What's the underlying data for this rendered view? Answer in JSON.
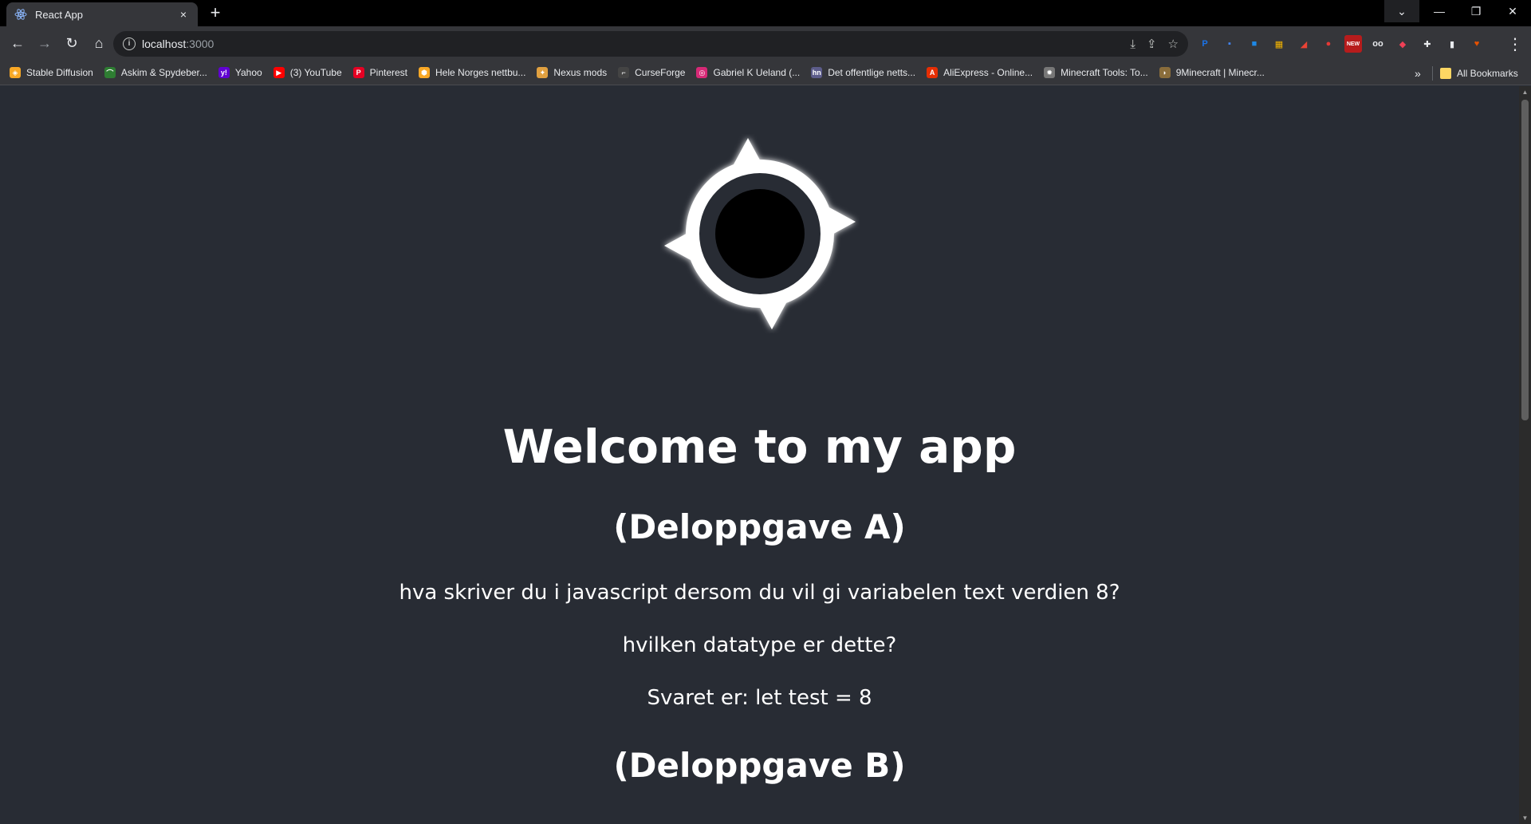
{
  "tab": {
    "title": "React App",
    "close_glyph": "×",
    "new_tab_glyph": "+"
  },
  "window_controls": {
    "tab_search": "⌄",
    "minimize": "—",
    "restore": "❐",
    "close": "✕"
  },
  "toolbar": {
    "back": "←",
    "forward": "→",
    "reload": "↻",
    "home": "⌂",
    "url_host": "localhost",
    "url_port": ":3000",
    "install_icon": "⤓",
    "share_icon": "⇪",
    "bookmark_star": "☆",
    "menu_icon": "⋮"
  },
  "extensions": [
    {
      "name": "ext-pdf-icon",
      "glyph": "P",
      "color": "#1a73e8"
    },
    {
      "name": "ext-tab-icon",
      "glyph": "▪",
      "color": "#4285f4"
    },
    {
      "name": "ext-folder-icon",
      "glyph": "■",
      "color": "#1e88e5"
    },
    {
      "name": "ext-color-icon",
      "glyph": "▦",
      "color": "#f4b400"
    },
    {
      "name": "ext-announce-icon",
      "glyph": "◢",
      "color": "#ea4335"
    },
    {
      "name": "ext-shield-icon",
      "glyph": "●",
      "color": "#e53935"
    },
    {
      "name": "ext-new-icon",
      "glyph": "NEW",
      "color": "#d32f2f"
    },
    {
      "name": "ext-glasses-icon",
      "glyph": "oo",
      "color": "#e8eaed"
    },
    {
      "name": "ext-pocket-icon",
      "glyph": "◆",
      "color": "#ef4056"
    },
    {
      "name": "extensions-puzzle-icon",
      "glyph": "✚",
      "color": "#e8eaed"
    },
    {
      "name": "side-panel-icon",
      "glyph": "▮",
      "color": "#e8eaed"
    },
    {
      "name": "profile-avatar-icon",
      "glyph": "♥",
      "color": "#e65100"
    }
  ],
  "bookmarks": [
    {
      "name": "bookmark-stable-diffusion",
      "label": "Stable Diffusion",
      "icon": "◈",
      "color": "#f9a825"
    },
    {
      "name": "bookmark-askim",
      "label": "Askim & Spydeber...",
      "icon": "⌒",
      "color": "#2e7d32"
    },
    {
      "name": "bookmark-yahoo",
      "label": "Yahoo",
      "icon": "y!",
      "color": "#6001d2"
    },
    {
      "name": "bookmark-youtube",
      "label": "(3) YouTube",
      "icon": "▶",
      "color": "#ff0000"
    },
    {
      "name": "bookmark-pinterest",
      "label": "Pinterest",
      "icon": "P",
      "color": "#e60023"
    },
    {
      "name": "bookmark-nettbutikk",
      "label": "Hele Norges nettbu...",
      "icon": "⬢",
      "color": "#f9a825"
    },
    {
      "name": "bookmark-nexus-mods",
      "label": "Nexus mods",
      "icon": "✦",
      "color": "#e0a040"
    },
    {
      "name": "bookmark-curseforge",
      "label": "CurseForge",
      "icon": "⌐",
      "color": "#444444"
    },
    {
      "name": "bookmark-instagram",
      "label": "Gabriel K Ueland (...",
      "icon": "◎",
      "color": "#d62976"
    },
    {
      "name": "bookmark-offentlige",
      "label": "Det offentlige netts...",
      "icon": "hn",
      "color": "#5c5c8a"
    },
    {
      "name": "bookmark-aliexpress",
      "label": "AliExpress - Online...",
      "icon": "A",
      "color": "#e62e04"
    },
    {
      "name": "bookmark-minecraft-tools",
      "label": "Minecraft Tools: To...",
      "icon": "✹",
      "color": "#777777"
    },
    {
      "name": "bookmark-9minecraft",
      "label": "9Minecraft | Minecr...",
      "icon": "◗",
      "color": "#8a6d3b"
    }
  ],
  "bookmarks_overflow": "»",
  "all_bookmarks": "All Bookmarks",
  "page": {
    "heading": "Welcome to my app",
    "section_a": "(Deloppgave A)",
    "question_1": "hva skriver du i javascript dersom du vil gi variabelen text verdien 8?",
    "question_2": "hvilken datatype er dette?",
    "answer": "Svaret er: let test = 8",
    "section_b": "(Deloppgave B)"
  },
  "scrollbar": {
    "up": "▲",
    "down": "▼"
  }
}
